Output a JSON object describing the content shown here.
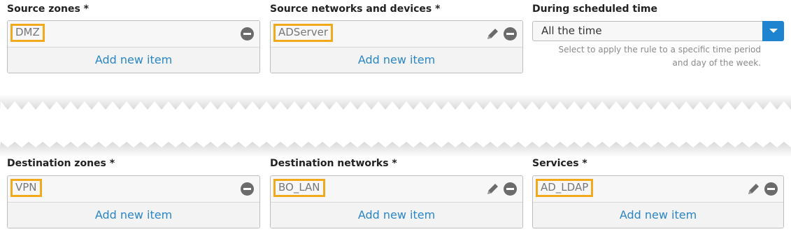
{
  "top": {
    "source_zones": {
      "label": "Source zones *",
      "items": [
        "DMZ"
      ],
      "add_label": "Add new item"
    },
    "source_networks": {
      "label": "Source networks and devices *",
      "items": [
        "ADServer"
      ],
      "add_label": "Add new item"
    },
    "schedule": {
      "label": "During scheduled time",
      "value": "All the time",
      "help_line1": "Select to apply the rule to a specific time period",
      "help_line2": "and day of the week."
    }
  },
  "bottom": {
    "destination_zones": {
      "label": "Destination zones *",
      "items": [
        "VPN"
      ],
      "add_label": "Add new item"
    },
    "destination_networks": {
      "label": "Destination networks *",
      "items": [
        "BO_LAN"
      ],
      "add_label": "Add new item"
    },
    "services": {
      "label": "Services *",
      "items": [
        "AD_LDAP"
      ],
      "add_label": "Add new item"
    }
  },
  "colors": {
    "accent": "#2a86c7",
    "highlight": "#f3a91c",
    "dropdown_button": "#1e84d0"
  },
  "icons": [
    "minus-circle-icon",
    "pencil-icon",
    "chevron-down-icon"
  ]
}
